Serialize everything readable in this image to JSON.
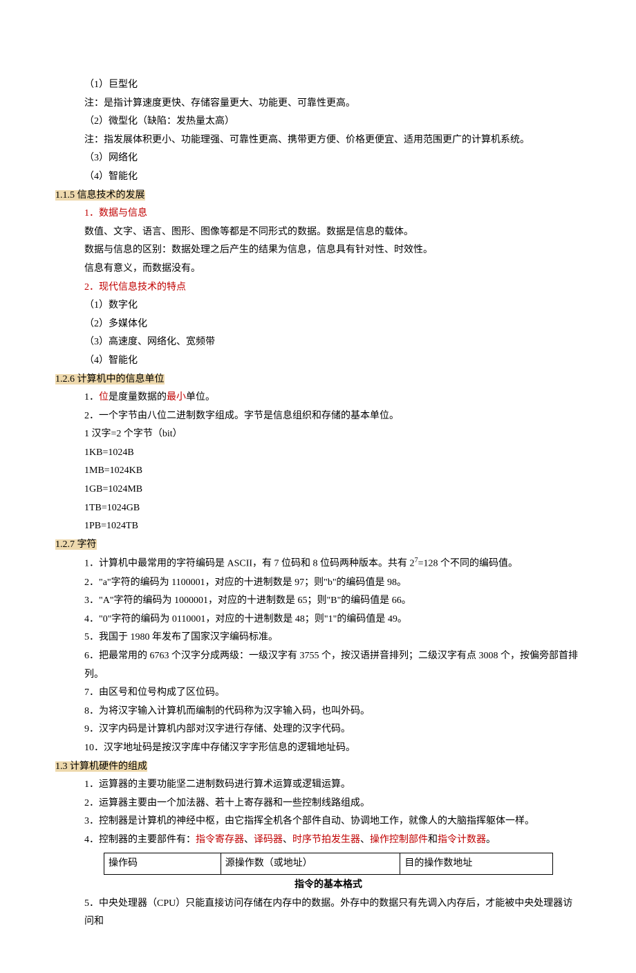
{
  "lines": {
    "l1": "（1）巨型化",
    "l2": "注：是指计算速度更快、存储容量更大、功能更、可靠性更高。",
    "l3": "（2）微型化（缺陷：发热量太高）",
    "l4": "注：指发展体积更小、功能理强、可靠性更高、携带更方便、价格更便宜、适用范围更广的计算机系统。",
    "l5": "（3）网络化",
    "l6": "（4）智能化"
  },
  "s115": {
    "title": "1.1.5 信息技术的发展",
    "h1": "1．数据与信息",
    "p1": "数值、文字、语言、图形、图像等都是不同形式的数据。数据是信息的载体。",
    "p2": "数据与信息的区别：数据处理之后产生的结果为信息，信息具有针对性、时效性。",
    "p3": "信息有意义，而数据没有。",
    "h2": "2．现代信息技术的特点",
    "li1": "（1）数字化",
    "li2": "（2）多媒体化",
    "li3": "（3）高速度、网络化、宽频带",
    "li4": "（4）智能化"
  },
  "s126": {
    "title": "1.2.6 计算机中的信息单位",
    "p1a": "1．",
    "p1b": "位",
    "p1c": "是度量数据的",
    "p1d": "最小",
    "p1e": "单位。",
    "p2": "2．一个字节由八位二进制数字组成。字节是信息组织和存储的基本单位。",
    "u1": "1 汉字=2 个字节（bit）",
    "u2": "1KB=1024B",
    "u3": "1MB=1024KB",
    "u4": "1GB=1024MB",
    "u5": "1TB=1024GB",
    "u6": "1PB=1024TB"
  },
  "s127": {
    "title": "1.2.7 字符",
    "p1a": "1．计算机中最常用的字符编码是 ASCII，有 7 位码和 8 位码两种版本。共有 2",
    "p1sup": "7",
    "p1b": "=128 个不同的编码值。",
    "p2": "2．\"a\"字符的编码为 1100001，对应的十进制数是 97；则\"b\"的编码值是 98。",
    "p3": "3．\"A\"字符的编码为 1000001，对应的十进制数是 65；则\"B\"的编码值是 66。",
    "p4": "4．\"0\"字符的编码为 0110001，对应的十进制数是 48；则\"1\"的编码值是 49。",
    "p5": "5．我国于 1980 年发布了国家汉字编码标准。",
    "p6": "6．把最常用的 6763 个汉字分成两级：一级汉字有 3755 个，按汉语拼音排列；二级汉字有点 3008 个，按偏旁部首排列。",
    "p7": "7．由区号和位号构成了区位码。",
    "p8": "8．为将汉字输入计算机而编制的代码称为汉字输入码，也叫外码。",
    "p9": "9．汉字内码是计算机内部对汉字进行存储、处理的汉字代码。",
    "p10": "10．汉字地址码是按汉字库中存储汉字字形信息的逻辑地址码。"
  },
  "s13": {
    "title": "1.3 计算机硬件的组成",
    "p1": "1．运算器的主要功能坚二进制数码进行算术运算或逻辑运算。",
    "p2": "2．运算器主要由一个加法器、若十上寄存器和一些控制线路组成。",
    "p3": "3．控制器是计算机的神经中枢，由它指挥全机各个部件自动、协调地工作，就像人的大脑指挥躯体一样。",
    "p4a": "4．控制器的主要部件有：",
    "p4b": "指令寄存器",
    "p4c": "、",
    "p4d": "译码器",
    "p4e": "、",
    "p4f": "时序节拍发生器",
    "p4g": "、",
    "p4h": "操作控制部件",
    "p4i": "和",
    "p4j": "指令计数器",
    "p4k": "。",
    "table": {
      "c1": "操作码",
      "c2": "源操作数（或地址）",
      "c3": "目的操作数地址"
    },
    "caption": "指令的基本格式",
    "p5": "5．中央处理器（CPU）只能直接访问存储在内存中的数据。外存中的数据只有先调入内存后，才能被中央处理器访问和"
  }
}
